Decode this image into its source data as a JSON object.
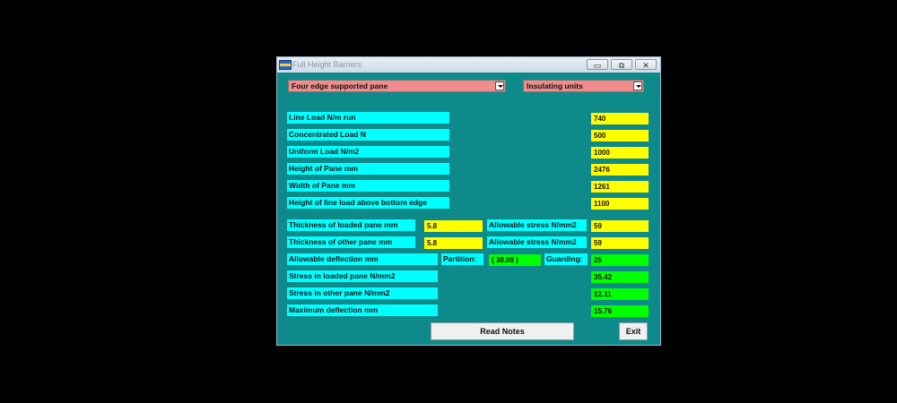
{
  "window": {
    "title": "Full Height Barriers",
    "controls": {
      "minimize": "▭",
      "restore": "⧉",
      "close": "✕"
    }
  },
  "selects": {
    "support_type": "Four edge supported pane",
    "unit_type": "Insulating units"
  },
  "inputs": [
    {
      "label": "Line Load N/m run",
      "value": "740"
    },
    {
      "label": "Concentrated Load N",
      "value": "500"
    },
    {
      "label": "Uniform Load N/m2",
      "value": "1000"
    },
    {
      "label": "Height of Pane mm",
      "value": "2476"
    },
    {
      "label": "Width of Pane mm",
      "value": "1261"
    },
    {
      "label": "Height of line load above bottom edge",
      "value": "1100"
    }
  ],
  "thickness": [
    {
      "label": "Thickness of loaded pane mm",
      "value": "5.8",
      "stress_label": "Allowable stress N/mm2",
      "stress_value": "59"
    },
    {
      "label": "Thickness of other pane mm",
      "value": "5.8",
      "stress_label": "Allowable stress N/mm2",
      "stress_value": "59"
    }
  ],
  "deflection": {
    "label": "Allowable deflection mm",
    "partition_label": "Partition:",
    "partition_value": "( 38.09 )",
    "guarding_label": "Guarding:",
    "guarding_value": "25"
  },
  "results": [
    {
      "label": "Stress in loaded pane N/mm2",
      "value": "35.42"
    },
    {
      "label": "Stress in other pane N/mm2",
      "value": "12.11"
    },
    {
      "label": "Maximum deflection mm",
      "value": "15.76"
    }
  ],
  "buttons": {
    "read_notes": "Read Notes",
    "exit": "Exit"
  },
  "colors": {
    "background": "#0f8a8a",
    "label": "#00ffff",
    "input": "#ffff00",
    "output": "#00ff00",
    "select": "#f08c8c"
  }
}
